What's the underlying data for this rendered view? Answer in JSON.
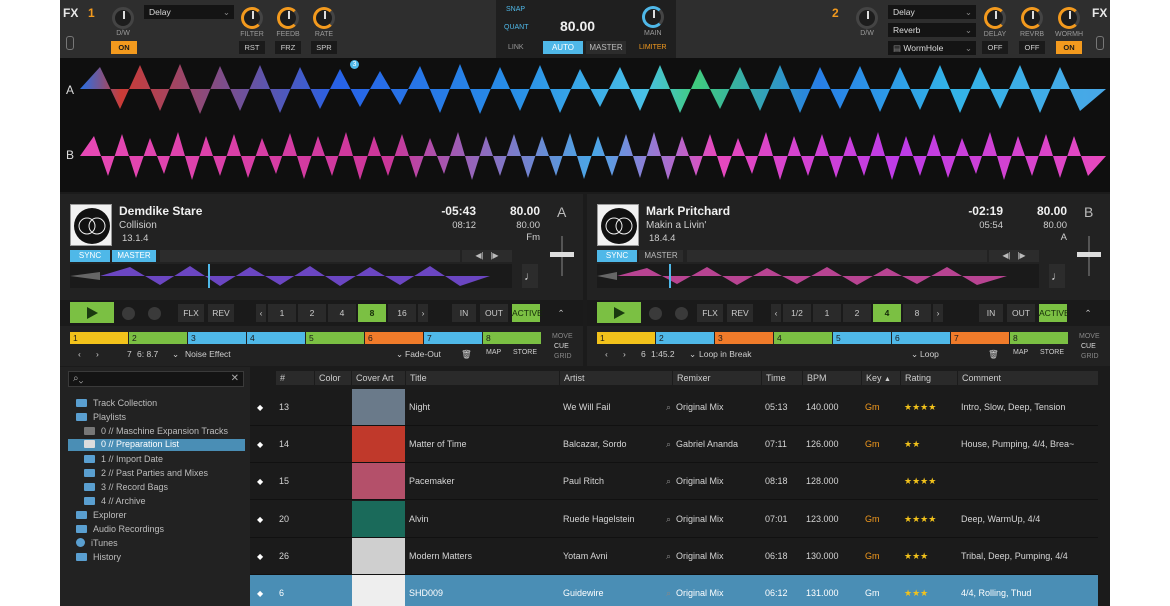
{
  "fx": {
    "label": "FX",
    "left": {
      "unit": "1",
      "dw": "D/W",
      "on": "ON",
      "effect": "Delay",
      "knobs": [
        "FILTER",
        "FEEDB",
        "RATE"
      ],
      "buttons": [
        "RST",
        "FRZ",
        "SPR"
      ]
    },
    "right": {
      "unit": "2",
      "dw": "D/W",
      "effects": [
        "Delay",
        "Reverb",
        "WormHole"
      ],
      "knobs": [
        "DELAY",
        "REVRB",
        "WORMH"
      ],
      "buttons": [
        "OFF",
        "OFF",
        "ON"
      ]
    },
    "master": {
      "snap": "SNAP",
      "quant": "QUANT",
      "bpm": "80.00",
      "link": "LINK",
      "auto": "AUTO",
      "master": "MASTER",
      "main": "MAIN",
      "limiter": "LIMITER"
    }
  },
  "overview": {
    "row_a": "A",
    "row_b": "B",
    "cue_marker": "3"
  },
  "deckA": {
    "title": "Demdike Stare",
    "artist": "Collision",
    "key": "13.1.4",
    "remaining": "-05:43",
    "elapsed": "08:12",
    "bpm": "80.00",
    "bpm2": "80.00",
    "keytxt": "Fm",
    "letter": "A",
    "sync": "SYNC",
    "master": "MASTER",
    "buttons": [
      "FLX",
      "REV"
    ],
    "loops": [
      "1",
      "2",
      "4",
      "8",
      "16"
    ],
    "active_loop": "8",
    "io": [
      "IN",
      "OUT",
      "ACTIVE"
    ],
    "cues": [
      "1",
      "2",
      "3",
      "4",
      "5",
      "6",
      "7",
      "8"
    ],
    "pos": "7",
    "pos_time": "6: 8.7",
    "effect": "Noise Effect",
    "fade": "Fade-Out",
    "map": "MAP",
    "store": "STORE",
    "move": "MOVE",
    "cue": "CUE",
    "grid": "GRID"
  },
  "deckB": {
    "title": "Mark Pritchard",
    "artist": "Makin a Livin'",
    "key": "18.4.4",
    "remaining": "-02:19",
    "elapsed": "05:54",
    "bpm": "80.00",
    "bpm2": "80.00",
    "keytxt": "A",
    "letter": "B",
    "sync": "SYNC",
    "master": "MASTER",
    "buttons": [
      "FLX",
      "REV"
    ],
    "loops": [
      "1/2",
      "1",
      "2",
      "4",
      "8"
    ],
    "active_loop": "4",
    "io": [
      "IN",
      "OUT",
      "ACTIVE"
    ],
    "cues": [
      "1",
      "2",
      "3",
      "4",
      "5",
      "6",
      "7",
      "8"
    ],
    "pos": "6",
    "pos_time": "1:45.2",
    "effect": "Loop in Break",
    "fade": "Loop",
    "map": "MAP",
    "store": "STORE",
    "move": "MOVE",
    "cue": "CUE",
    "grid": "GRID"
  },
  "browser": {
    "tree": [
      "Track Collection",
      "Playlists",
      "0 // Maschine Expansion Tracks",
      "0 // Preparation List",
      "1 // Import Date",
      "2 // Past Parties and Mixes",
      "3 // Record Bags",
      "4 // Archive",
      "Explorer",
      "Audio Recordings",
      "iTunes",
      "History"
    ],
    "columns": [
      "#",
      "Color",
      "Cover Art",
      "Title",
      "Artist",
      "Remixer",
      "Time",
      "BPM",
      "Key",
      "Rating",
      "Comment"
    ],
    "rows": [
      {
        "n": "13",
        "title": "Night",
        "artist": "We Will Fail",
        "remixer": "Original Mix",
        "time": "05:13",
        "bpm": "140.000",
        "key": "Gm",
        "stars": "★★★★",
        "comment": "Intro, Slow, Deep, Tension"
      },
      {
        "n": "14",
        "title": "Matter of Time",
        "artist": "Balcazar, Sordo",
        "remixer": "Gabriel Ananda",
        "time": "07:11",
        "bpm": "126.000",
        "key": "Gm",
        "stars": "★★",
        "comment": "House, Pumping, 4/4, Brea~"
      },
      {
        "n": "15",
        "title": "Pacemaker",
        "artist": "Paul Ritch",
        "remixer": "Original Mix",
        "time": "08:18",
        "bpm": "128.000",
        "key": "",
        "stars": "★★★★",
        "comment": ""
      },
      {
        "n": "20",
        "title": "Alvin",
        "artist": "Ruede Hagelstein",
        "remixer": "Original Mix",
        "time": "07:01",
        "bpm": "123.000",
        "key": "Gm",
        "stars": "★★★★",
        "comment": "Deep, WarmUp, 4/4"
      },
      {
        "n": "26",
        "title": "Modern Matters",
        "artist": "Yotam Avni",
        "remixer": "Original Mix",
        "time": "06:18",
        "bpm": "130.000",
        "key": "Gm",
        "stars": "★★★",
        "comment": "Tribal, Deep, Pumping, 4/4"
      },
      {
        "n": "6",
        "title": "SHD009",
        "artist": "Guidewire",
        "remixer": "Original Mix",
        "time": "06:12",
        "bpm": "131.000",
        "key": "Gm",
        "stars": "★★★",
        "comment": "4/4, Rolling, Thud"
      }
    ]
  }
}
